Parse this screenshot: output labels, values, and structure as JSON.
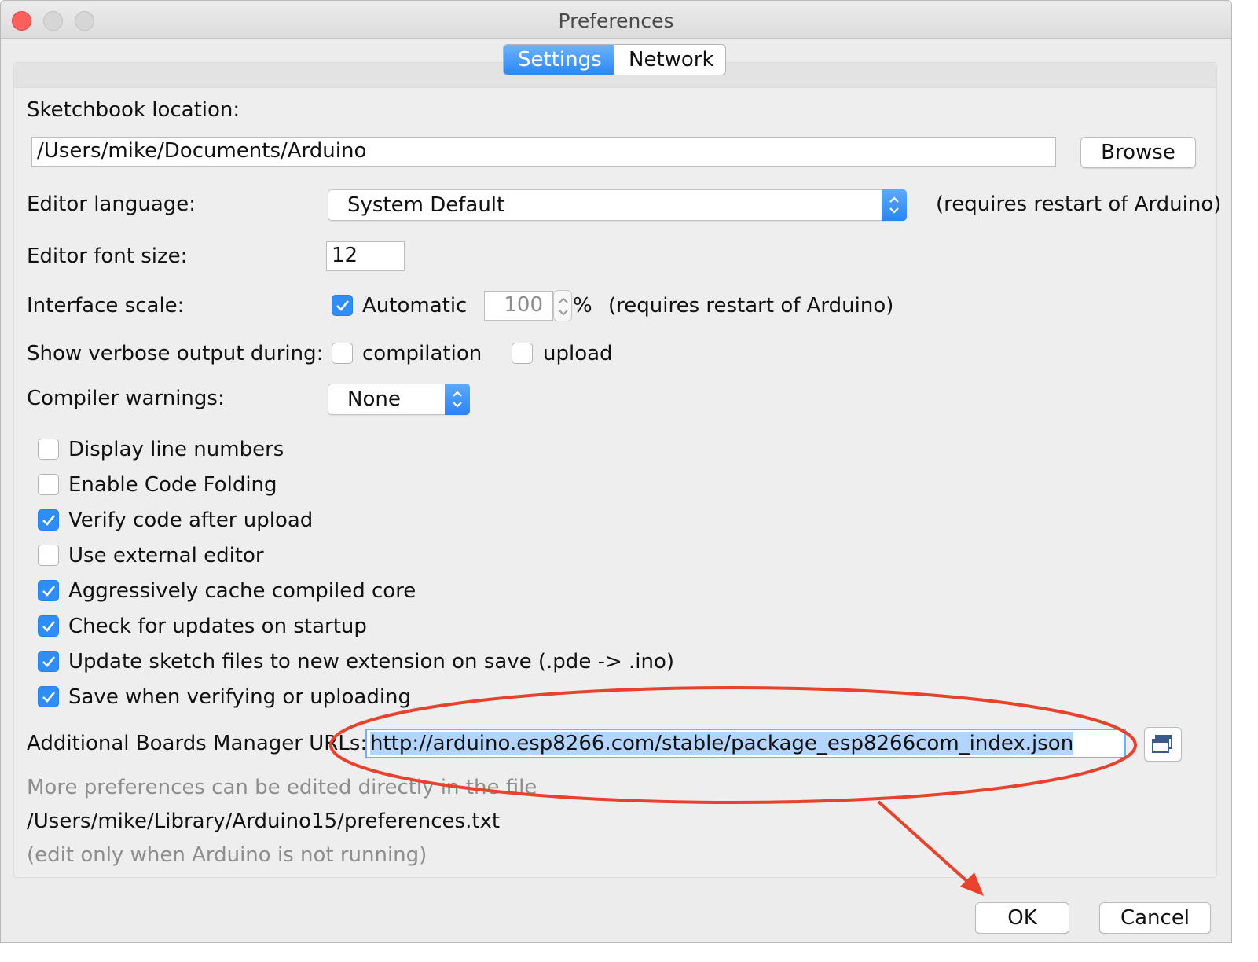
{
  "window": {
    "title": "Preferences"
  },
  "tabs": [
    {
      "label": "Settings",
      "active": true
    },
    {
      "label": "Network",
      "active": false
    }
  ],
  "sketchbook": {
    "label": "Sketchbook location:",
    "value": "/Users/mike/Documents/Arduino",
    "browse_label": "Browse"
  },
  "editor_language": {
    "label": "Editor language:",
    "value": "System Default",
    "note": "(requires restart of Arduino)"
  },
  "font_size": {
    "label": "Editor font size:",
    "value": "12"
  },
  "interface_scale": {
    "label": "Interface scale:",
    "automatic_label": "Automatic",
    "automatic_checked": true,
    "value": "100",
    "unit": "%",
    "note": "(requires restart of Arduino)"
  },
  "verbose": {
    "label": "Show verbose output during:",
    "compilation_label": "compilation",
    "compilation_checked": false,
    "upload_label": "upload",
    "upload_checked": false
  },
  "compiler_warnings": {
    "label": "Compiler warnings:",
    "value": "None"
  },
  "options": [
    {
      "label": "Display line numbers",
      "checked": false
    },
    {
      "label": "Enable Code Folding",
      "checked": false
    },
    {
      "label": "Verify code after upload",
      "checked": true
    },
    {
      "label": "Use external editor",
      "checked": false
    },
    {
      "label": "Aggressively cache compiled core",
      "checked": true
    },
    {
      "label": "Check for updates on startup",
      "checked": true
    },
    {
      "label": "Update sketch files to new extension on save (.pde -> .ino)",
      "checked": true
    },
    {
      "label": "Save when verifying or uploading",
      "checked": true
    }
  ],
  "boards_urls": {
    "label": "Additional Boards Manager URLs:",
    "value": "http://arduino.esp8266.com/stable/package_esp8266com_index.json"
  },
  "footer": {
    "more_prefs": "More preferences can be edited directly in the file",
    "path": "/Users/mike/Library/Arduino15/preferences.txt",
    "note": "(edit only when Arduino is not running)"
  },
  "buttons": {
    "ok": "OK",
    "cancel": "Cancel"
  },
  "colors": {
    "accent": "#2f8ef5",
    "annotation": "#e8412d"
  }
}
